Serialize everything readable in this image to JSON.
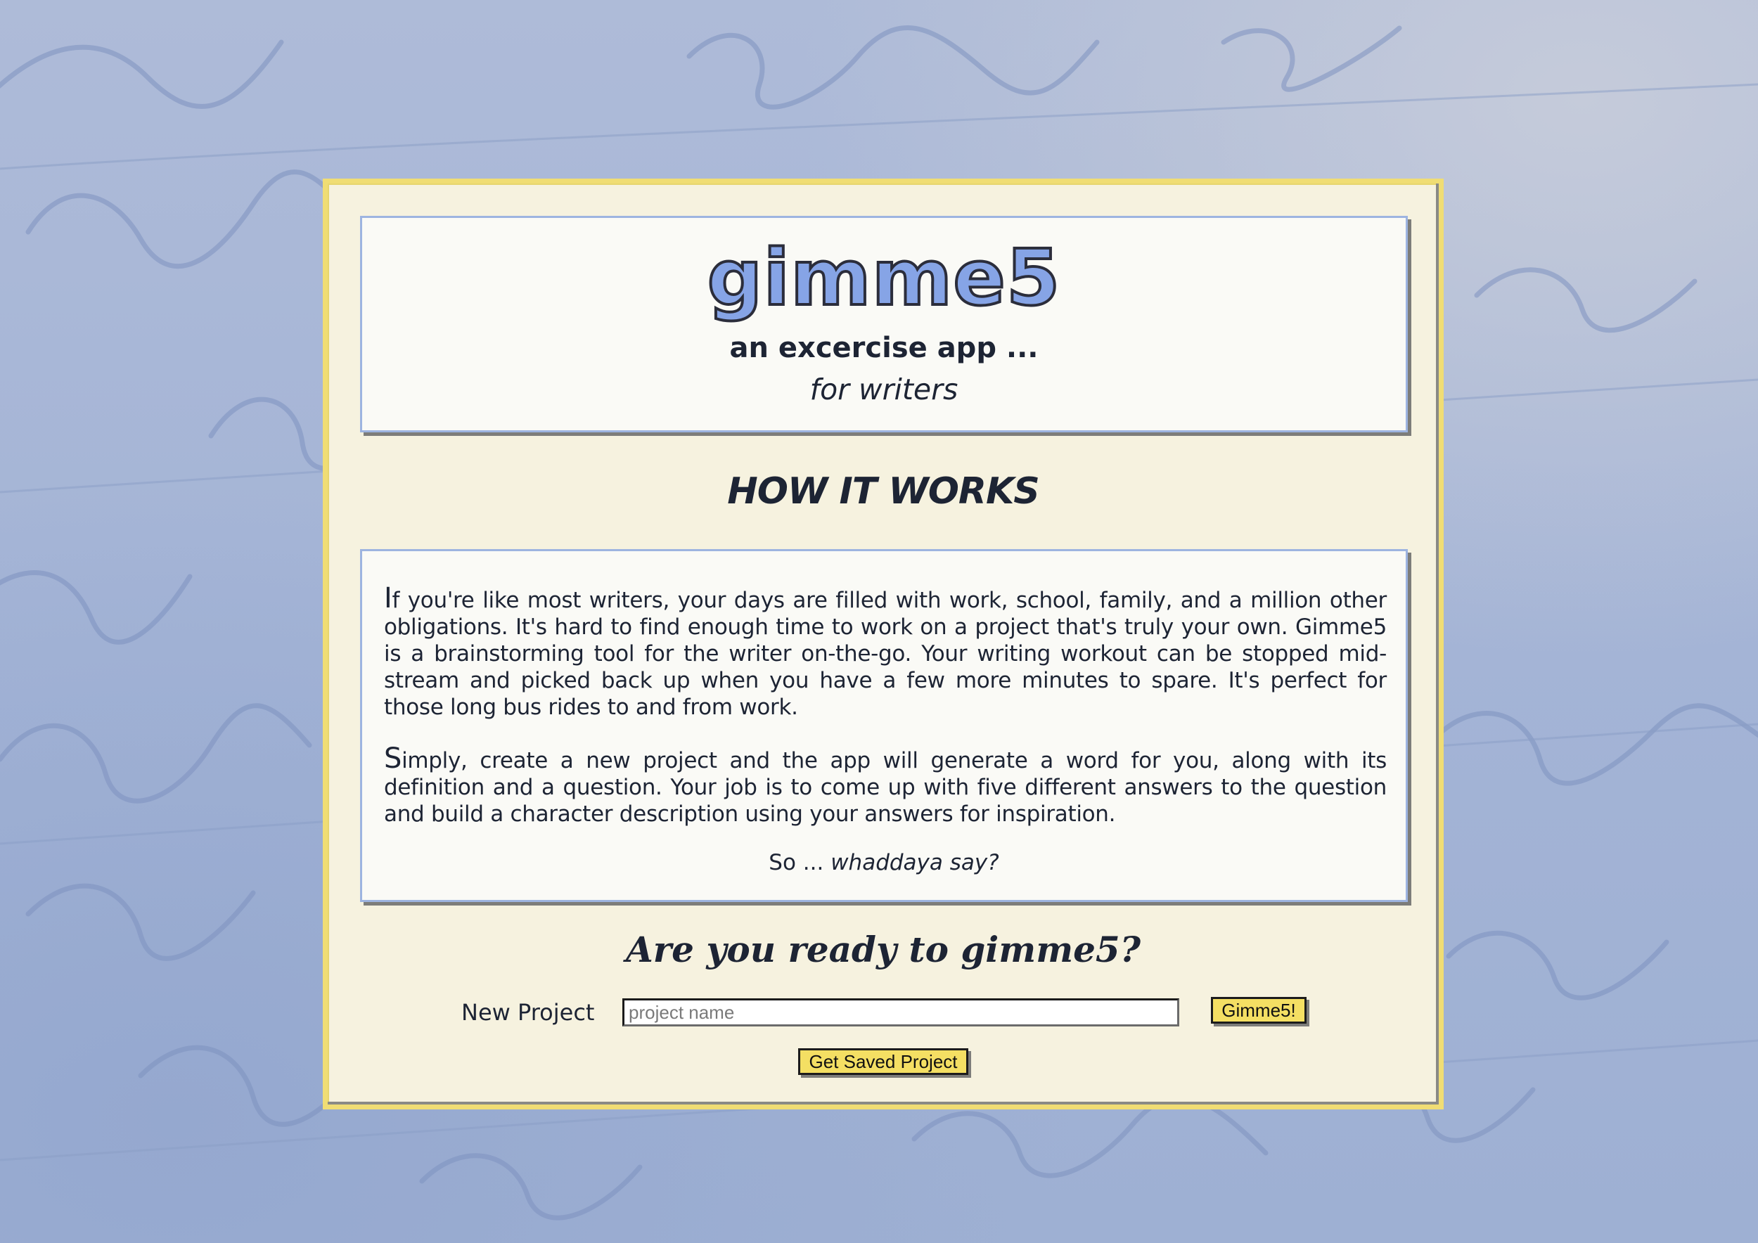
{
  "header": {
    "app_title": "gimme5",
    "subtitle": "an excercise app ...",
    "tagline": "for writers"
  },
  "how_it_works": {
    "heading": "HOW IT WORKS",
    "paragraph_1": "If you're like most writers, your days are filled with work, school, family, and a million other obligations. It's hard to find enough time to work on a project that's truly your own. Gimme5 is a brainstorming tool for the writer on-the-go. Your writing workout can be stopped mid-stream and picked back up when you have a few more minutes to spare. It's perfect for those long bus rides to and from work.",
    "paragraph_2": "Simply, create a new project and the app will generate a word for you, along with its definition and a question. Your job is to come up with five different answers to the question and build a character description using your answers for inspiration.",
    "closing_prefix": "So ... ",
    "closing_emphasis": "whaddaya say?"
  },
  "start": {
    "heading": "Are you ready to gimme5?",
    "new_project_label": "New Project",
    "project_name_placeholder": "project name",
    "project_name_value": "",
    "gimme_button": "Gimme5!",
    "saved_button": "Get Saved Project"
  },
  "colors": {
    "background": "#a7b6d6",
    "card": "#f6f2df",
    "card_border": "#f0dd74",
    "panel_border": "#9db4e0",
    "title_fill": "#86a4e6",
    "button": "#f4df63",
    "text": "#1d2434"
  }
}
